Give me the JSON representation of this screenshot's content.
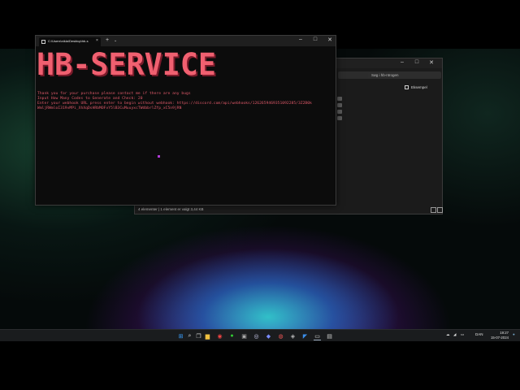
{
  "terminal": {
    "tab_title": "C:\\Users\\nikla\\Desktop\\hb-s",
    "newtab": "+",
    "dropdown": "⌄",
    "close_tab": "×",
    "banner": "HB-SERVICE",
    "lines": [
      "Thank you for your purchase please contact me if there are any bugs",
      "Input How Many Codes to Generate and Check: 20",
      "Enter your webhook URL press enter to begin without webhook: https://discord.com/api/webhooks/1262659469351092285/3Z2B0k",
      "WmljRWmloI319vMPi_XhXqDsHRbMOFvY5lB3CuMuuyxcTWdbbrlZfp_xC5n9jRN"
    ],
    "cursor_char": "_",
    "colors": {
      "text": "#e05a6a",
      "banner": "#f06070",
      "banner_shadow": "#7a1a2a",
      "cursor": "#b03bd6"
    }
  },
  "explorer": {
    "search_placeholder": "Søg i hb-ntrogen",
    "preview_label": "Eksempel",
    "status": "4 elementer  |  1 element er valgt 3,44 KB"
  },
  "window_controls": {
    "minimize": "–",
    "maximize": "□",
    "close": "✕"
  },
  "taskbar": {
    "language": "DAN",
    "time": "19:27",
    "date": "15-07-2024",
    "icons": [
      "windows-start-icon",
      "search-icon",
      "task-view-icon",
      "file-explorer-icon",
      "chrome-icon",
      "spotify-icon",
      "store-icon",
      "steam-icon",
      "discord-icon",
      "edge-icon",
      "app-icon",
      "terminal-icon",
      "vscode-icon",
      "notepad-icon"
    ]
  }
}
